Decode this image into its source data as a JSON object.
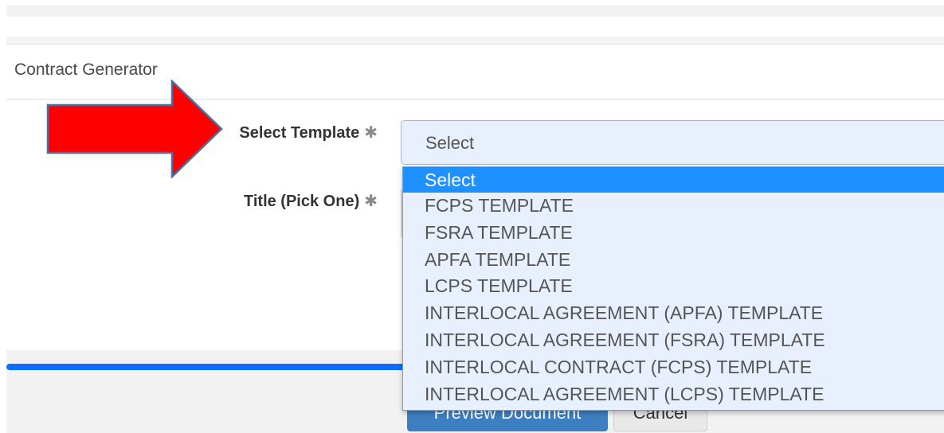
{
  "panel": {
    "title": "Contract Generator"
  },
  "form": {
    "template_label": "Select Template",
    "title_label": "Title (Pick One)",
    "required_marker": "✱",
    "template_select_value": "Select"
  },
  "dropdown": {
    "options": [
      "Select",
      "FCPS TEMPLATE",
      "FSRA TEMPLATE",
      "APFA TEMPLATE",
      "LCPS TEMPLATE",
      "INTERLOCAL AGREEMENT (APFA) TEMPLATE",
      "INTERLOCAL AGREEMENT (FSRA) TEMPLATE",
      "INTERLOCAL CONTRACT (FCPS) TEMPLATE",
      "INTERLOCAL AGREEMENT (LCPS) TEMPLATE"
    ],
    "selected_index": 0
  },
  "footer": {
    "preview_label": "Preview Document",
    "cancel_label": "Cancel"
  },
  "colors": {
    "arrow_fill": "#ff0000",
    "arrow_stroke": "#4a6fa5",
    "highlight": "#1e90ff",
    "select_bg": "#e8f0fe",
    "primary_button": "#3d7fc1"
  },
  "icons": {
    "annotation": "red-arrow-icon"
  }
}
